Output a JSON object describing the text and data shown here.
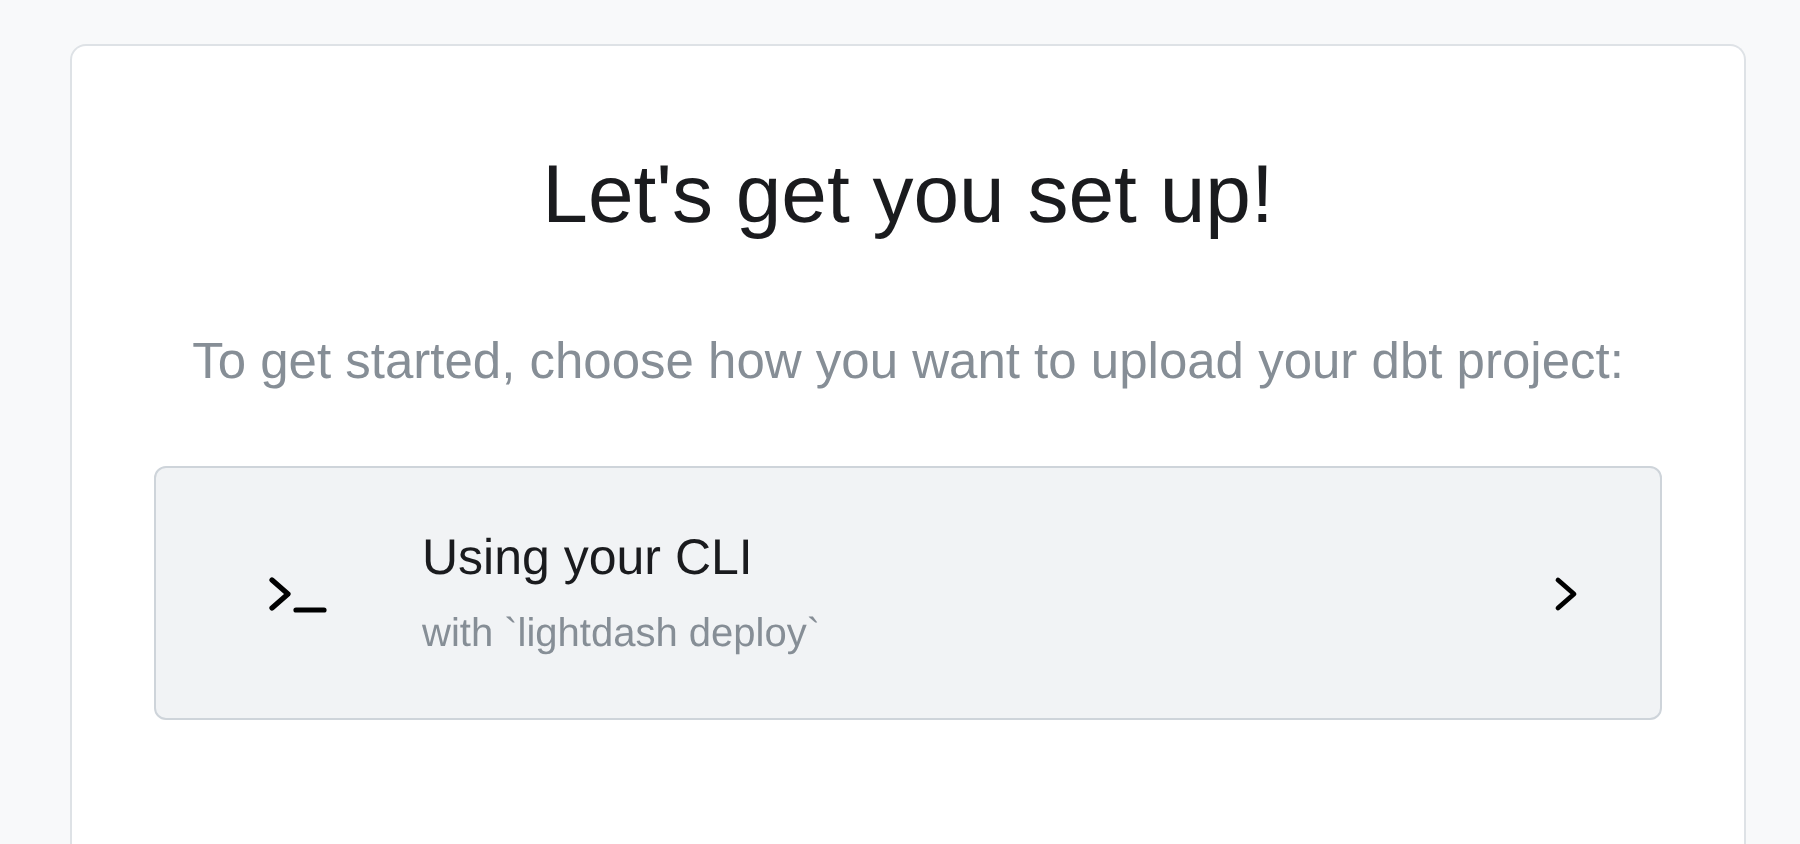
{
  "title": "Let's get you set up!",
  "subtitle": "To get started, choose how you want to upload your dbt project:",
  "options": [
    {
      "kind": "cli",
      "title": "Using your CLI",
      "description": "with `lightdash deploy`"
    }
  ]
}
